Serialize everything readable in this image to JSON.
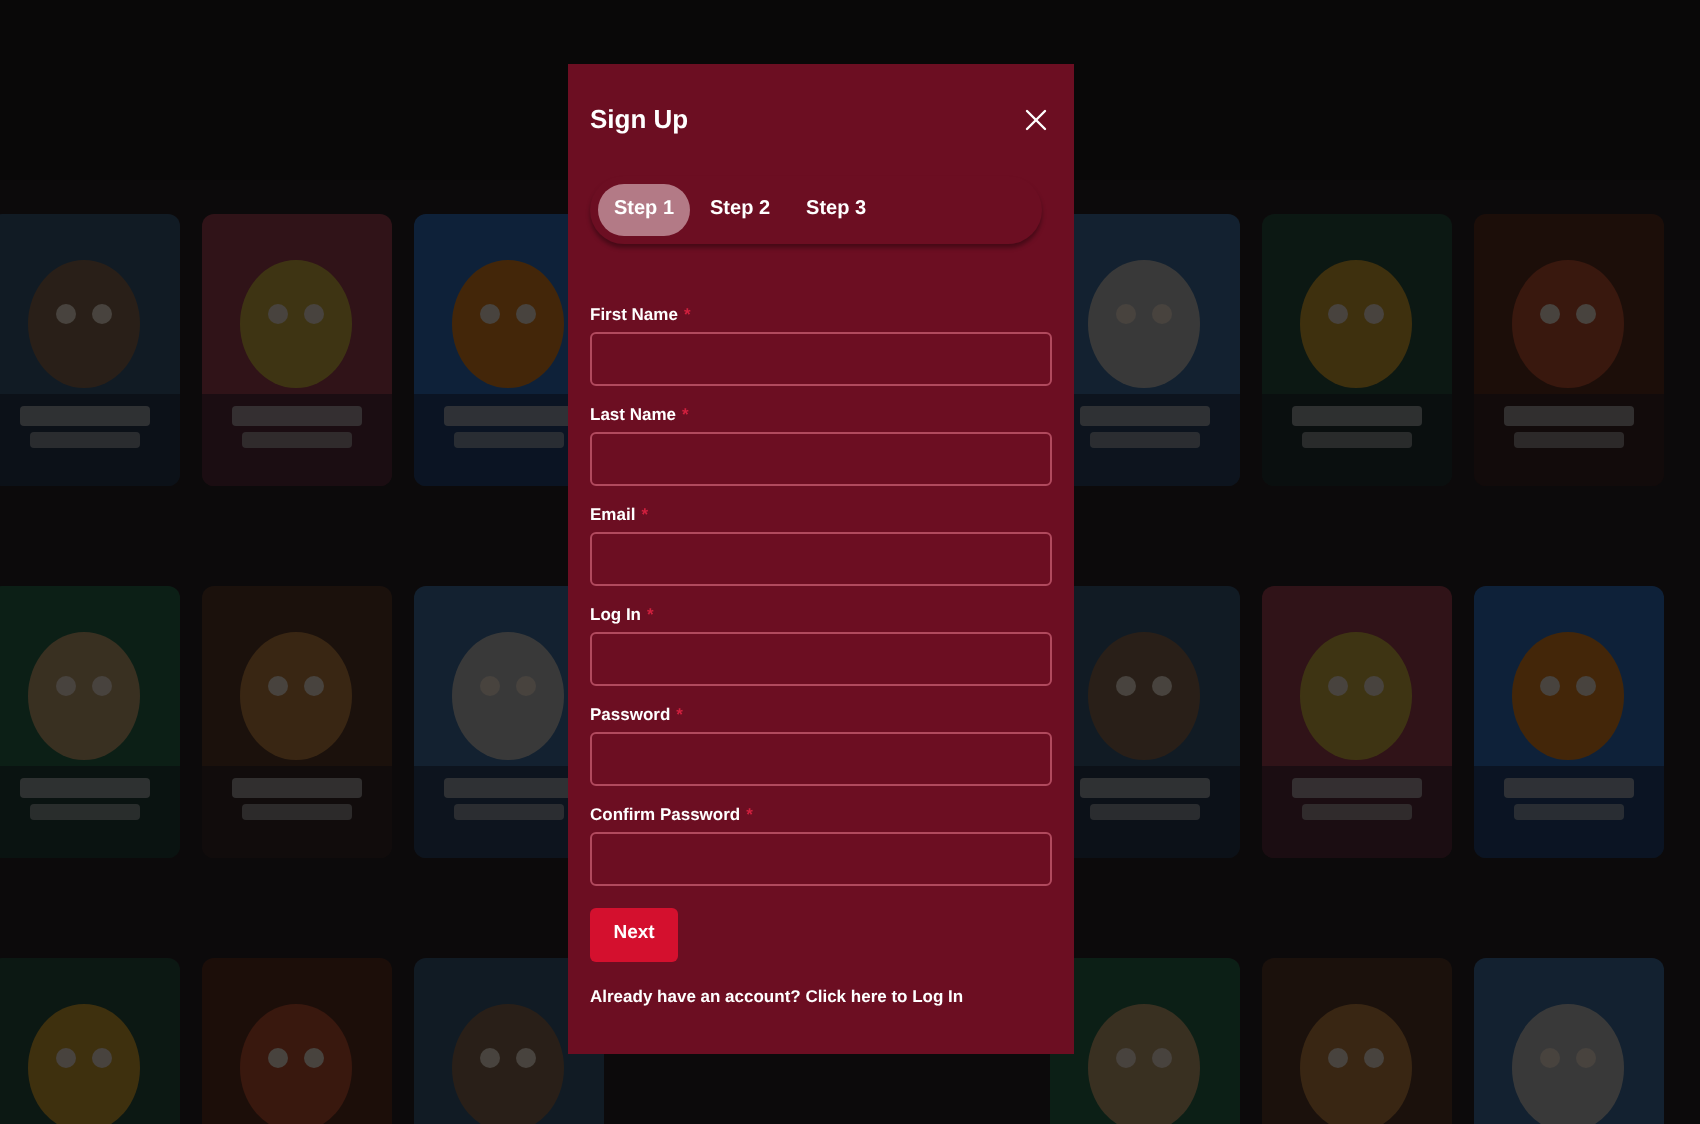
{
  "dialog": {
    "title": "Sign Up",
    "tabs": [
      {
        "label": "Step 1",
        "selected": true
      },
      {
        "label": "Step 2",
        "selected": false
      },
      {
        "label": "Step 3",
        "selected": false
      }
    ],
    "fields": [
      {
        "label": "First Name",
        "required_mark": "*"
      },
      {
        "label": "Last Name",
        "required_mark": "*"
      },
      {
        "label": "Email",
        "required_mark": "*"
      },
      {
        "label": "Log In",
        "required_mark": "*"
      },
      {
        "label": "Password",
        "required_mark": "*"
      },
      {
        "label": "Confirm Password",
        "required_mark": "*"
      }
    ],
    "next_button": "Next",
    "footer": {
      "text": "Already have an account?",
      "link": "Click here to Log In"
    }
  }
}
